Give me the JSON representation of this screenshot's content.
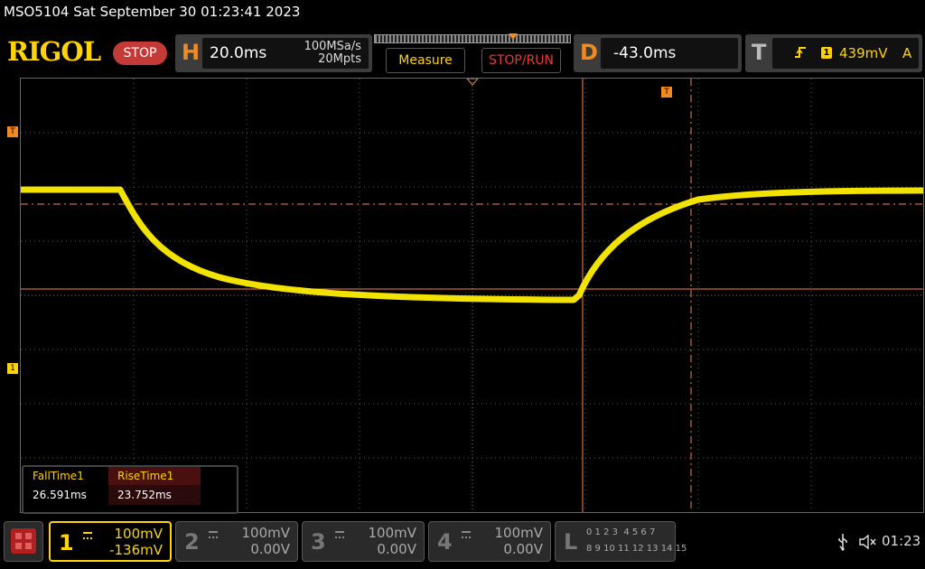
{
  "header": {
    "title": "MSO5104  Sat September 30 01:23:41 2023",
    "logo": "RIGOL",
    "run_state": "STOP"
  },
  "horizontal": {
    "letter": "H",
    "timebase": "20.0ms",
    "sample_rate": "100MSa/s",
    "memory_depth": "20Mpts"
  },
  "buttons": {
    "measure": "Measure",
    "stop_run": "STOP/RUN"
  },
  "delay": {
    "letter": "D",
    "value": "-43.0ms"
  },
  "trigger": {
    "letter": "T",
    "source": "1",
    "level": "439mV",
    "mode": "A"
  },
  "markers": {
    "trigger_level": "T",
    "ch1_offset": "1",
    "trigger_pos": "T"
  },
  "measurements": {
    "headers": [
      "FallTime1",
      "RiseTime1"
    ],
    "values": [
      "26.591ms",
      "23.752ms"
    ]
  },
  "channels": [
    {
      "num": "1",
      "scale": "100mV",
      "offset": "-136mV",
      "active": true
    },
    {
      "num": "2",
      "scale": "100mV",
      "offset": "0.00V",
      "active": false
    },
    {
      "num": "3",
      "scale": "100mV",
      "offset": "0.00V",
      "active": false
    },
    {
      "num": "4",
      "scale": "100mV",
      "offset": "0.00V",
      "active": false
    }
  ],
  "logic": {
    "letter": "L",
    "row1": "0 1 2 3  4 5 6 7",
    "row2": "8 9 10 11 12 13 14 15"
  },
  "status": {
    "time": "01:23"
  },
  "colors": {
    "trace": "#ffee00",
    "accent": "#f28a1e",
    "stop": "#c43a37",
    "cursor": "#ff7f50"
  },
  "icons": [
    "usb-icon",
    "mute-icon",
    "grid-menu-icon",
    "edge-rising-icon"
  ]
}
